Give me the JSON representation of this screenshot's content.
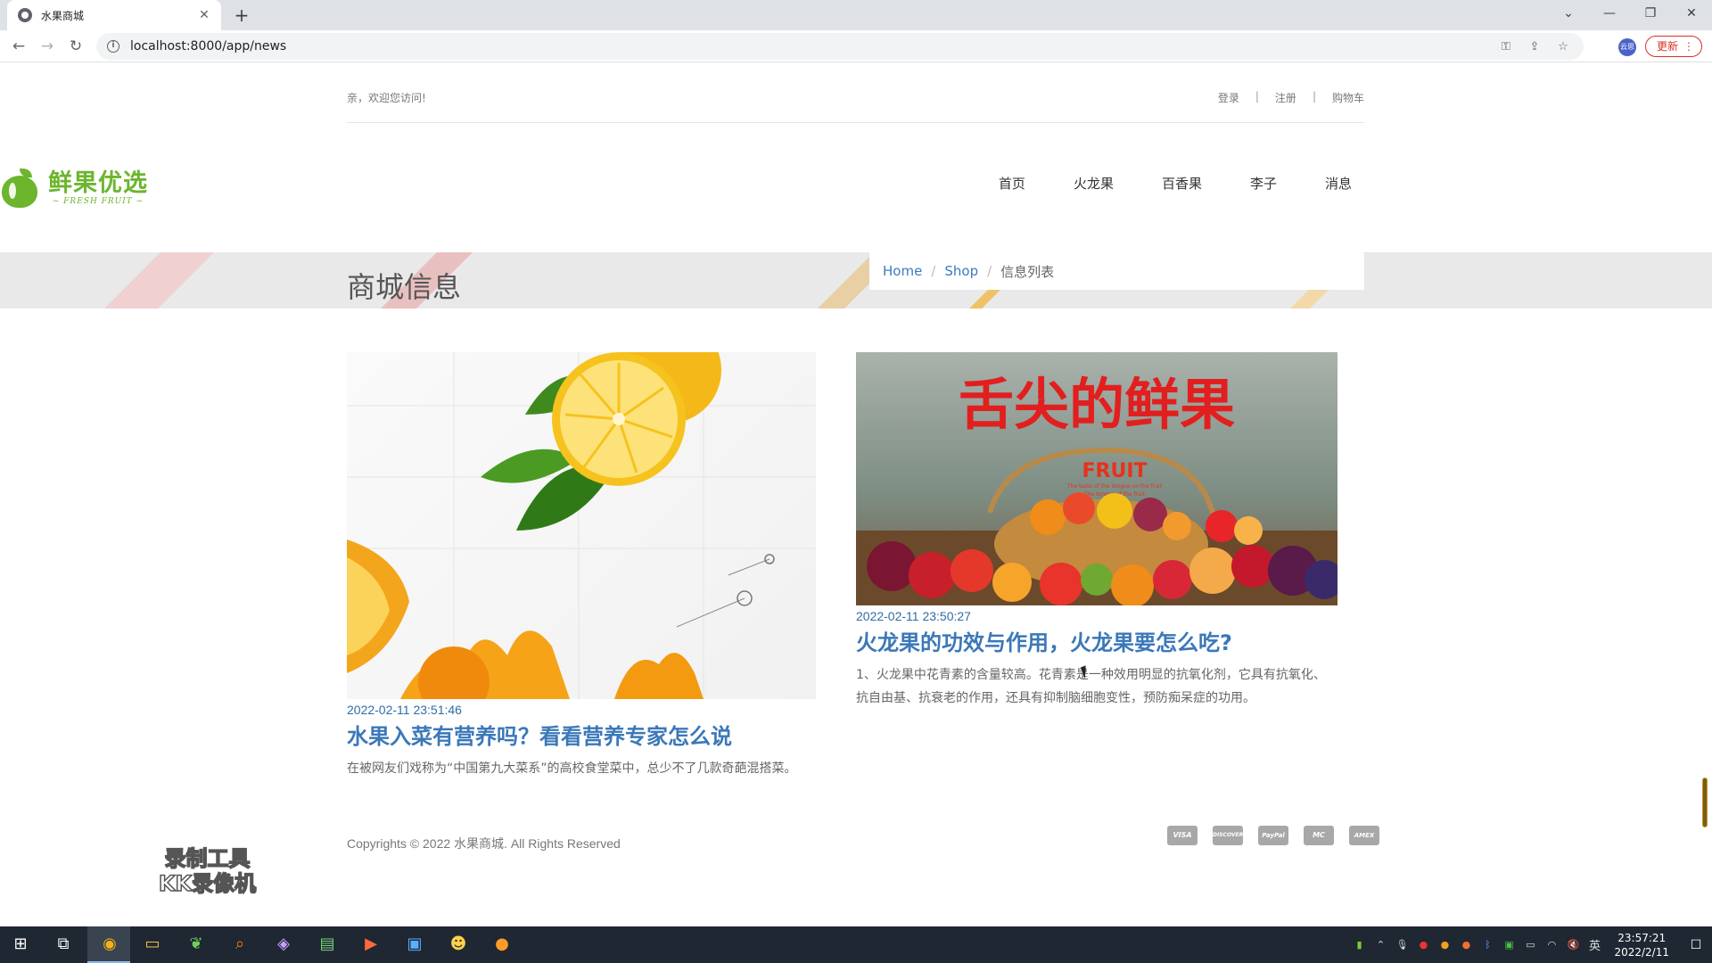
{
  "browser": {
    "tab_title": "水果商城",
    "url": "localhost:8000/app/news",
    "profile_label": "云思",
    "update_label": "更新"
  },
  "site": {
    "welcome": "亲，欢迎您访问!",
    "top_links": [
      "登录",
      "注册",
      "购物车"
    ],
    "logo_cn": "鲜果优选",
    "logo_en": "~ FRESH FRUIT ~",
    "nav": [
      "首页",
      "火龙果",
      "百香果",
      "李子",
      "消息"
    ],
    "page_title": "商城信息",
    "breadcrumb": {
      "home": "Home",
      "shop": "Shop",
      "current": "信息列表"
    }
  },
  "news": [
    {
      "date": "2022-02-11 23:51:46",
      "title": "水果入菜有营养吗？看看营养专家怎么说",
      "excerpt": "在被网友们戏称为“中国第九大菜系”的高校食堂菜中，总少不了几款奇葩混搭菜。"
    },
    {
      "date": "2022-02-11 23:50:27",
      "title": "火龙果的功效与作用，火龙果要怎么吃?",
      "excerpt": "1、火龙果中花青素的含量较高。花青素是一种效用明显的抗氧化剂，它具有抗氧化、抗自由基、抗衰老的作用，还具有抑制脑细胞变性，预防痴呆症的功用。",
      "image_text": {
        "headline": "舌尖的鲜果",
        "fruit": "FRUIT",
        "tag1": "The taste of the tongue on the fruit",
        "tag2": "The tongue of the fruit"
      }
    }
  ],
  "footer": {
    "copyright": "Copyrights © 2022 水果商城. All Rights Reserved",
    "payments": [
      "VISA",
      "DISCOVER",
      "PayPal",
      "MC",
      "AMEX"
    ]
  },
  "watermark": {
    "line1": "录制工具",
    "line2": "KK录像机"
  },
  "taskbar": {
    "time": "23:57:21",
    "date": "2022/2/11",
    "ime": "英"
  },
  "colors": {
    "brand_green": "#6cb52d",
    "link_blue": "#3b78b8",
    "banner_bg": "#e9e9e9"
  }
}
